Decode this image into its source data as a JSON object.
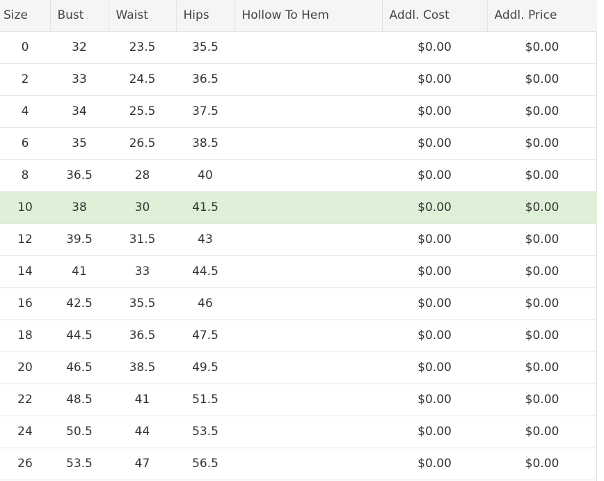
{
  "table": {
    "columns": [
      "Size",
      "Bust",
      "Waist",
      "Hips",
      "Hollow To Hem",
      "Addl. Cost",
      "Addl. Price"
    ],
    "rows": [
      {
        "size": "0",
        "bust": "32",
        "waist": "23.5",
        "hips": "35.5",
        "hollow": "",
        "cost": "$0.00",
        "price": "$0.00"
      },
      {
        "size": "2",
        "bust": "33",
        "waist": "24.5",
        "hips": "36.5",
        "hollow": "",
        "cost": "$0.00",
        "price": "$0.00"
      },
      {
        "size": "4",
        "bust": "34",
        "waist": "25.5",
        "hips": "37.5",
        "hollow": "",
        "cost": "$0.00",
        "price": "$0.00"
      },
      {
        "size": "6",
        "bust": "35",
        "waist": "26.5",
        "hips": "38.5",
        "hollow": "",
        "cost": "$0.00",
        "price": "$0.00"
      },
      {
        "size": "8",
        "bust": "36.5",
        "waist": "28",
        "hips": "40",
        "hollow": "",
        "cost": "$0.00",
        "price": "$0.00"
      },
      {
        "size": "10",
        "bust": "38",
        "waist": "30",
        "hips": "41.5",
        "hollow": "",
        "cost": "$0.00",
        "price": "$0.00"
      },
      {
        "size": "12",
        "bust": "39.5",
        "waist": "31.5",
        "hips": "43",
        "hollow": "",
        "cost": "$0.00",
        "price": "$0.00"
      },
      {
        "size": "14",
        "bust": "41",
        "waist": "33",
        "hips": "44.5",
        "hollow": "",
        "cost": "$0.00",
        "price": "$0.00"
      },
      {
        "size": "16",
        "bust": "42.5",
        "waist": "35.5",
        "hips": "46",
        "hollow": "",
        "cost": "$0.00",
        "price": "$0.00"
      },
      {
        "size": "18",
        "bust": "44.5",
        "waist": "36.5",
        "hips": "47.5",
        "hollow": "",
        "cost": "$0.00",
        "price": "$0.00"
      },
      {
        "size": "20",
        "bust": "46.5",
        "waist": "38.5",
        "hips": "49.5",
        "hollow": "",
        "cost": "$0.00",
        "price": "$0.00"
      },
      {
        "size": "22",
        "bust": "48.5",
        "waist": "41",
        "hips": "51.5",
        "hollow": "",
        "cost": "$0.00",
        "price": "$0.00"
      },
      {
        "size": "24",
        "bust": "50.5",
        "waist": "44",
        "hips": "53.5",
        "hollow": "",
        "cost": "$0.00",
        "price": "$0.00"
      },
      {
        "size": "26",
        "bust": "53.5",
        "waist": "47",
        "hips": "56.5",
        "hollow": "",
        "cost": "$0.00",
        "price": "$0.00"
      }
    ],
    "selected_size": "10",
    "colors": {
      "header_bg": "#f5f5f5",
      "selected_row_bg": "#dff0d8",
      "border": "#e2e2e2"
    }
  }
}
